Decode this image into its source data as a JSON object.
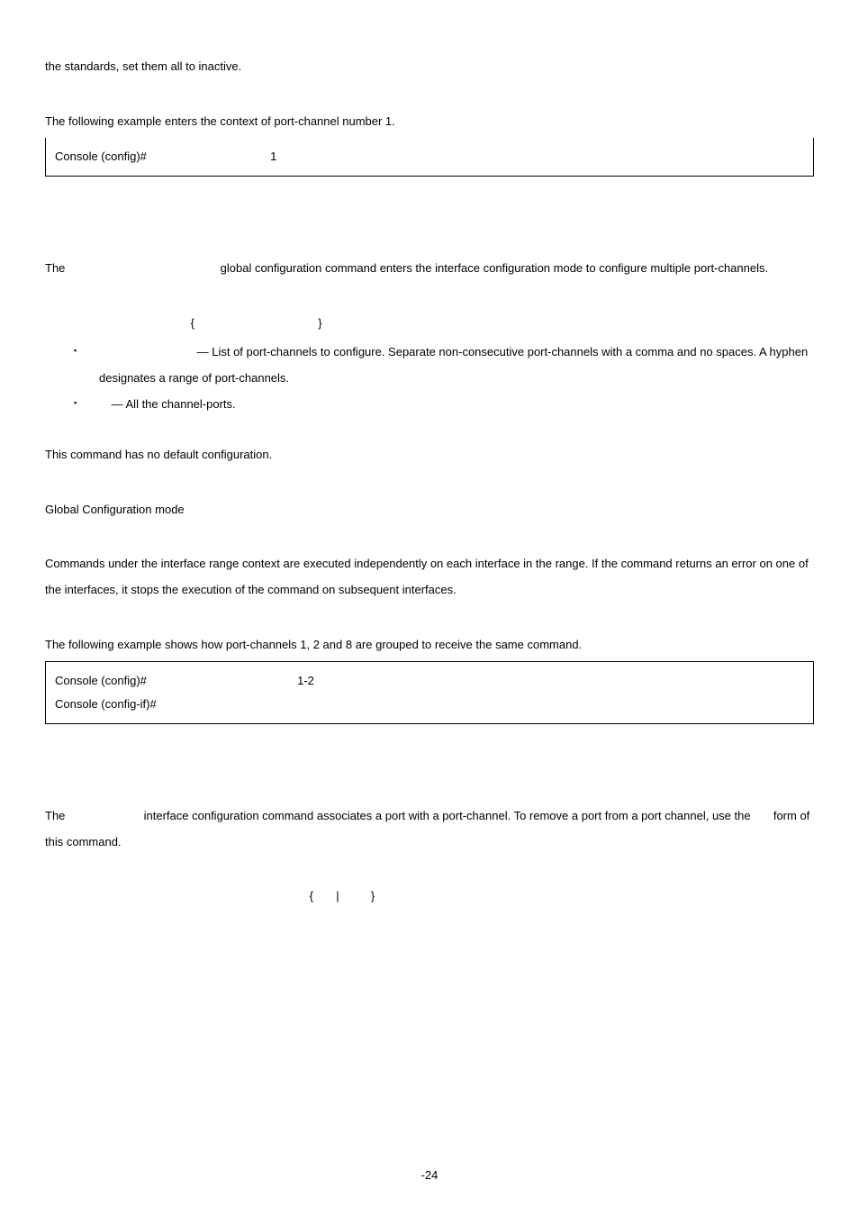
{
  "p1": "the standards, set them all to inactive.",
  "p2": "The following example enters the context of port-channel number 1.",
  "code1": {
    "prefix": "Console (config)# ",
    "arg": "1"
  },
  "p3a": "The ",
  "p3b": " global configuration command enters the interface configuration mode to configure multiple port-channels.",
  "syntax1a": "{",
  "syntax1b": "}",
  "bullet1": " — List of port-channels to configure. Separate non-consecutive port-channels with a comma and no spaces. A hyphen designates a range of port-channels.",
  "bullet2": " — All the channel-ports.",
  "p4": "This command has no default configuration.",
  "p5": "Global Configuration mode",
  "p6": "Commands under the interface range context are executed independently on each interface in the range. If the command returns an error on one of the interfaces, it stops the execution of the command on subsequent interfaces.",
  "p7": "The following example shows how port-channels 1, 2 and 8 are grouped to receive the same command.",
  "code2": {
    "line1_prefix": "Console (config)# ",
    "line1_arg": "1-2",
    "line2_prefix": "Console (config-if)# "
  },
  "p8a": "The ",
  "p8b": " interface configuration command associates a port with a port-channel. To remove a port from a port channel, use the ",
  "p8c": " form of this command.",
  "syntax2a": "{",
  "syntax2b": "|",
  "syntax2c": "}",
  "page_num": "-24"
}
